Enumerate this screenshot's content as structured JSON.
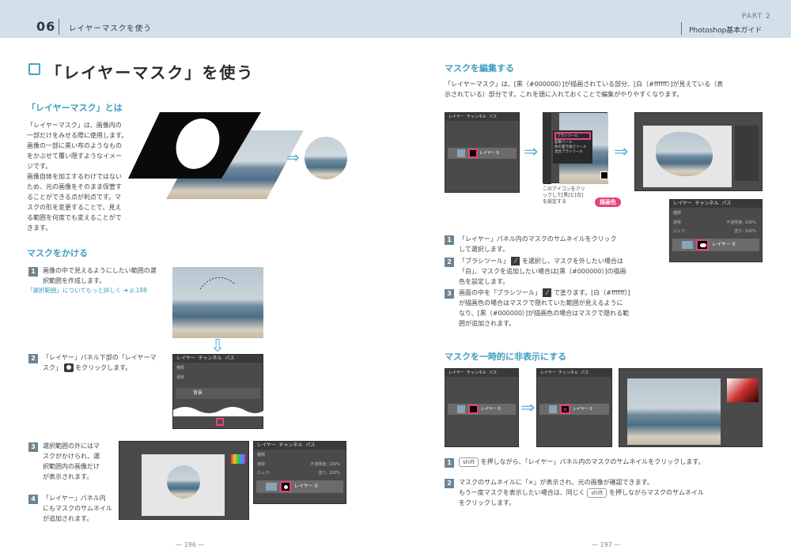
{
  "header": {
    "chapter_number": "06",
    "chapter_title": "レイヤーマスクを使う",
    "part_label": "PART 2",
    "guide_label": "Photoshop基本ガイド"
  },
  "left": {
    "title": "「レイヤーマスク」を使う",
    "section1": {
      "heading": "「レイヤーマスク」とは",
      "lines": [
        "「レイヤーマスク」は、画像内の",
        "一部だけをみせる際に使用します。",
        "画像の一部に黒い布のようなもの",
        "をかぶせて覆い隠すようなイメー",
        "ジです。",
        "画像自体を加工するわけではない",
        "ため、元の画像をそのまま保管す",
        "ることができる点が利点です。マ",
        "スクの形を変更することで、見え",
        "る範囲を何度でも変えることがで",
        "きます。"
      ]
    },
    "section2": {
      "heading": "マスクをかける",
      "step1_num": "1",
      "step1_lines": [
        "画像の中で見えるようにしたい範囲の選",
        "択範囲を作成します。"
      ],
      "step1_ref": "「選択範囲」についてもっと詳しく ➜ p.188",
      "step2_num": "2",
      "step2_lines": [
        "「レイヤー」パネル下部の「レイヤーマ",
        "スク」",
        "をクリックします。"
      ],
      "step3_num": "3",
      "step3_lines": [
        "選択範囲の外にはマ",
        "スクがかけられ、選",
        "択範囲内の画像だけ",
        "が表示されます。"
      ],
      "step4_num": "4",
      "step4_lines": [
        "「レイヤー」パネル内",
        "にもマスクのサムネイル",
        "が追加されます。"
      ]
    },
    "panel": {
      "tabs": [
        "レイヤー",
        "チャンネル",
        "パス"
      ],
      "kind": "種類",
      "mode": "通常",
      "opacity_label": "不透明度:",
      "opacity": "100%",
      "lock": "ロック:",
      "fill_label": "塗り:",
      "fill": "100%",
      "bg_layer": "背景",
      "layer0": "レイヤー 0"
    },
    "page_number": "— 196 —"
  },
  "right": {
    "section3": {
      "heading": "マスクを編集する",
      "intro_lines": [
        "「レイヤーマスク」は、[黒（#000000）]が描画されている部分、[白（#ffffff）]が見えている（表",
        "示されている）部分です。これを頭に入れておくことで編集がやりやすくなります。"
      ],
      "caption_lines": [
        "このアイコンをクリ",
        "ックして[黒]と[白]",
        "を設定する"
      ],
      "tag": "描画色",
      "menu_items": [
        "ブラシツール",
        "鉛筆ツール",
        "色の置き換えツール",
        "混合ブラシツール"
      ],
      "step1_num": "1",
      "step1_lines": [
        "「レイヤー」パネル内のマスクのサムネイルをクリック",
        "して選択します。"
      ],
      "step2_num": "2",
      "step2_lines": [
        "「ブラシツール」",
        "を選択し、マスクを外したい場合は",
        "「白」、マスクを追加したい場合は[黒（#000000）]の描画",
        "色を設定します。"
      ],
      "step3_num": "3",
      "step3_lines": [
        "画面の中を「ブラシツール」",
        "で塗ります。[白（#ffffff）]",
        "が描画色の場合はマスクで隠れていた範囲が見えるように",
        "なり、[黒（#000000）]が描画色の場合はマスクで隠れる範",
        "囲が追加されます。"
      ]
    },
    "section4": {
      "heading": "マスクを一時的に非表示にする",
      "step1_num": "1",
      "step1_key": "shift",
      "step1_text": "を押しながら、「レイヤー」パネル内のマスクのサムネイルをクリックします。",
      "step2_num": "2",
      "step2_lines": [
        "マスクのサムネイルに「×」が表示され、元の画像が確認できます。",
        "もう一度マスクを表示したい場合は、同じく",
        "を押しながらマスクのサムネイル",
        "をクリックします。"
      ],
      "step2_key": "shift"
    },
    "page_number": "— 197 —"
  },
  "colors": {
    "header_bg": "#d2e0ea",
    "accent_blue": "#3e9cc3",
    "step_badge": "#6e8494",
    "highlight_pink": "#e8417f"
  }
}
